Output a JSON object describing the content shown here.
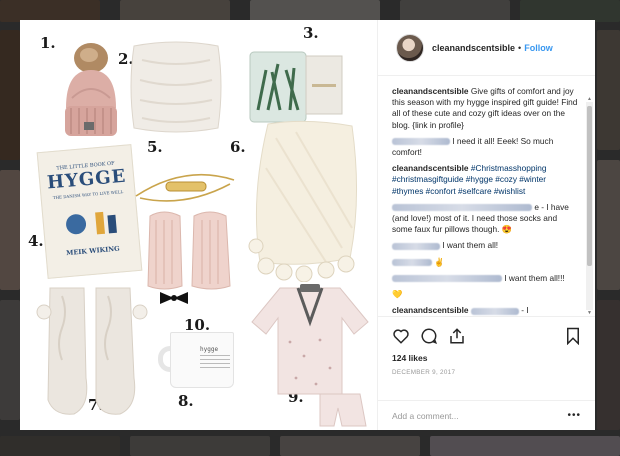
{
  "post": {
    "username": "cleanandscentsible",
    "follow_label": "Follow",
    "likes": "124 likes",
    "date": "DECEMBER 9, 2017",
    "add_comment_placeholder": "Add a comment...",
    "more_label": "•••"
  },
  "caption": {
    "author": "cleanandscentsible",
    "text": "Give gifts of comfort and joy this season with my hygge inspired gift guide! Find all of these cute and cozy gift ideas over on the blog. {link in profile}"
  },
  "comments": [
    {
      "author": "",
      "text": "I need it all! Eeek! So much comfort!"
    },
    {
      "author": "cleanandscentsible",
      "text": "#Christmasshopping #christmasgiftguide #hygge #cozy #winter #thymes #confort #selfcare #wishlist"
    },
    {
      "author": "",
      "text": "e - I have (and love!) most of it. I need those socks and some faux fur pillows though. 😍"
    },
    {
      "author": "",
      "text": "I want them all!"
    },
    {
      "author": "",
      "text": "✌️"
    },
    {
      "author": "",
      "text": "I want them all!!!"
    },
    {
      "author": "",
      "text": "💛"
    },
    {
      "author": "cleanandscentsible",
      "text": "- I"
    }
  ],
  "guide": {
    "numbers": [
      "1.",
      "2.",
      "3.",
      "4.",
      "5.",
      "6.",
      "7.",
      "8.",
      "9.",
      "10."
    ],
    "book": {
      "line1": "THE LITTLE BOOK OF",
      "line2": "HYGGE",
      "line3": "THE DANISH WAY TO LIVE WELL",
      "author": "MEIK WIKING"
    },
    "mug_text": "hygge"
  },
  "colors": {
    "accent": "#3897f0",
    "text": "#262626",
    "muted": "#999999",
    "divider": "#efefef"
  },
  "icons": [
    "heart-icon",
    "comment-icon",
    "share-icon",
    "bookmark-icon"
  ]
}
